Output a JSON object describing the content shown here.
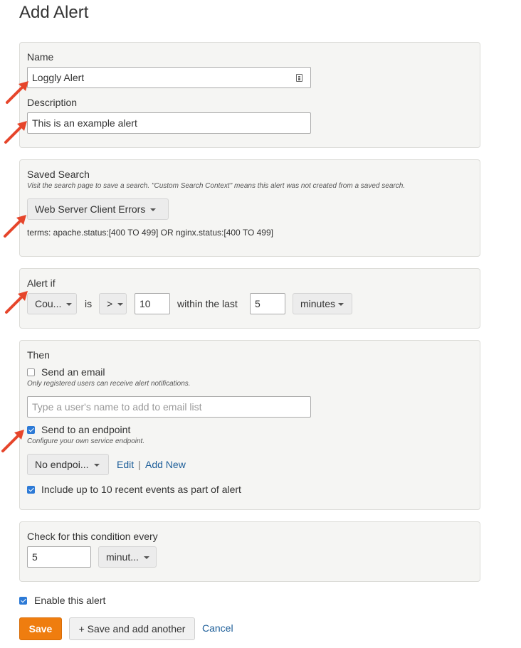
{
  "page": {
    "title": "Add Alert"
  },
  "name_section": {
    "label": "Name",
    "value": "Loggly Alert",
    "description_label": "Description",
    "description_value": "This is an example alert"
  },
  "saved_search": {
    "label": "Saved Search",
    "hint": "Visit the search page to save a search. \"Custom Search Context\" means this alert was not created from a saved search.",
    "selected": "Web Server Client Errors",
    "terms": "terms: apache.status:[400 TO 499] OR nginx.status:[400 TO 499]"
  },
  "alert_if": {
    "label": "Alert if",
    "aggregate": "Cou...",
    "is_text": "is",
    "operator": ">",
    "threshold": "10",
    "within_text": "within the last",
    "period_value": "5",
    "period_unit": "minutes"
  },
  "then": {
    "label": "Then",
    "send_email_label": "Send an email",
    "send_email_checked": false,
    "email_hint": "Only registered users can receive alert notifications.",
    "email_placeholder": "Type a user's name to add to email list",
    "send_endpoint_label": "Send to an endpoint",
    "send_endpoint_checked": true,
    "endpoint_hint": "Configure your own service endpoint.",
    "endpoint_selected": "No endpoi...",
    "edit_link": "Edit",
    "separator": "|",
    "add_new_link": "Add New",
    "include_events_label": "Include up to 10 recent events as part of alert",
    "include_events_checked": true
  },
  "check_every": {
    "label": "Check for this condition every",
    "value": "5",
    "unit": "minut..."
  },
  "enable": {
    "label": "Enable this alert",
    "checked": true
  },
  "actions": {
    "save": "Save",
    "save_add_another": "+ Save and add another",
    "cancel": "Cancel"
  },
  "colors": {
    "accent": "#ef7d0f",
    "link": "#1d5e99",
    "checkbox": "#2d7ad6",
    "annotation_arrow": "#e6452b"
  }
}
